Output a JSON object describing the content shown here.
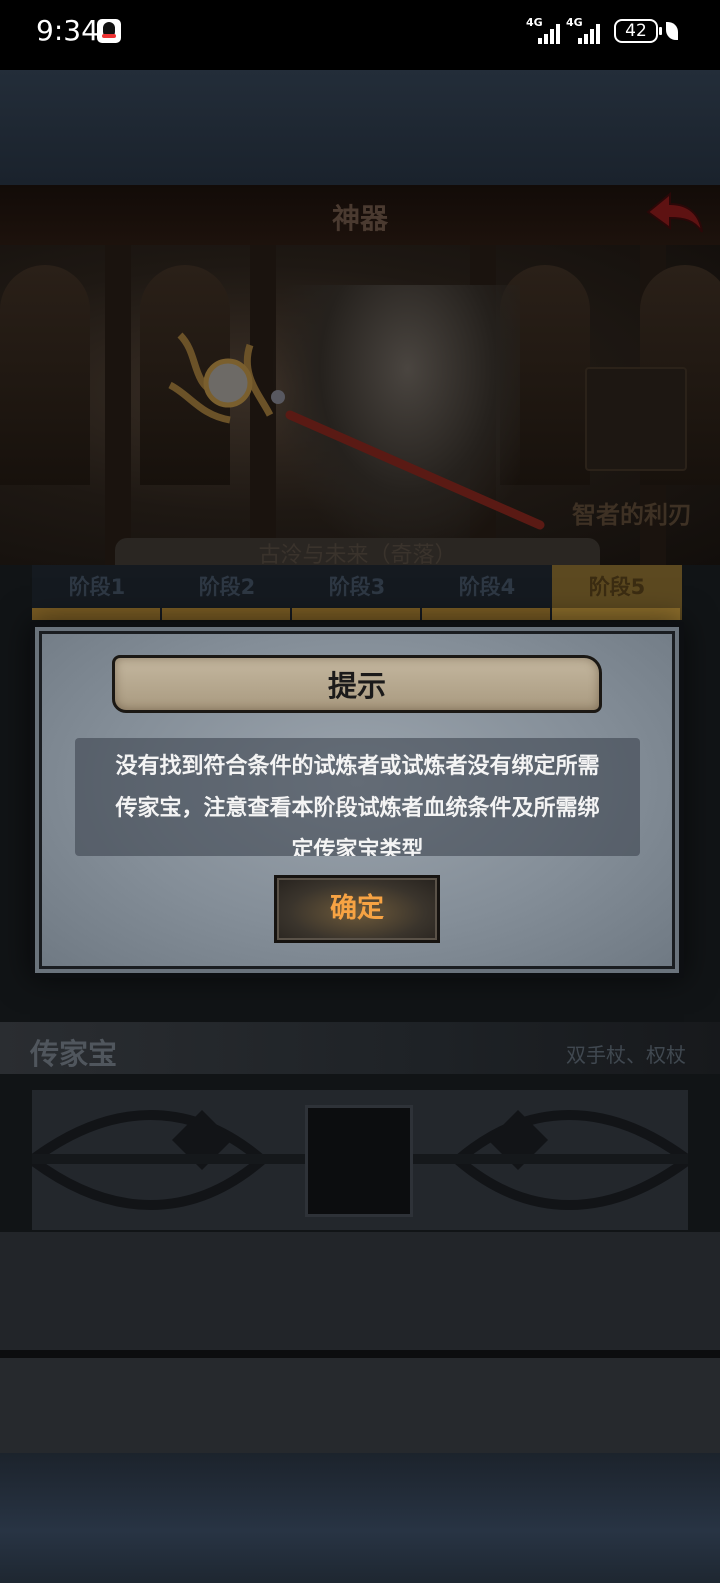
{
  "status_bar": {
    "time": "9:34",
    "network_1": "4G",
    "network_2": "4G",
    "battery": "42"
  },
  "header": {
    "title": "神器",
    "back_icon": "back-arrow-icon"
  },
  "hero": {
    "item_label": "智者的利刃",
    "name_plate": "古泠与未来（奇落）"
  },
  "stage_tabs": [
    {
      "label": "阶段1",
      "active": false
    },
    {
      "label": "阶段2",
      "active": false
    },
    {
      "label": "阶段3",
      "active": false
    },
    {
      "label": "阶段4",
      "active": false
    },
    {
      "label": "阶段5",
      "active": true
    }
  ],
  "heirloom": {
    "title": "传家宝",
    "types": "双手杖、权杖"
  },
  "dialog": {
    "title": "提示",
    "message": "没有找到符合条件的试炼者或试炼者没有绑定所需传家宝，注意查看本阶段试炼者血统条件及所需绑定传家宝类型",
    "confirm_label": "确定"
  },
  "colors": {
    "confirm_text": "#f7a343",
    "active_tab": "#5c4920",
    "dialog_bg": "#8d97a1"
  }
}
